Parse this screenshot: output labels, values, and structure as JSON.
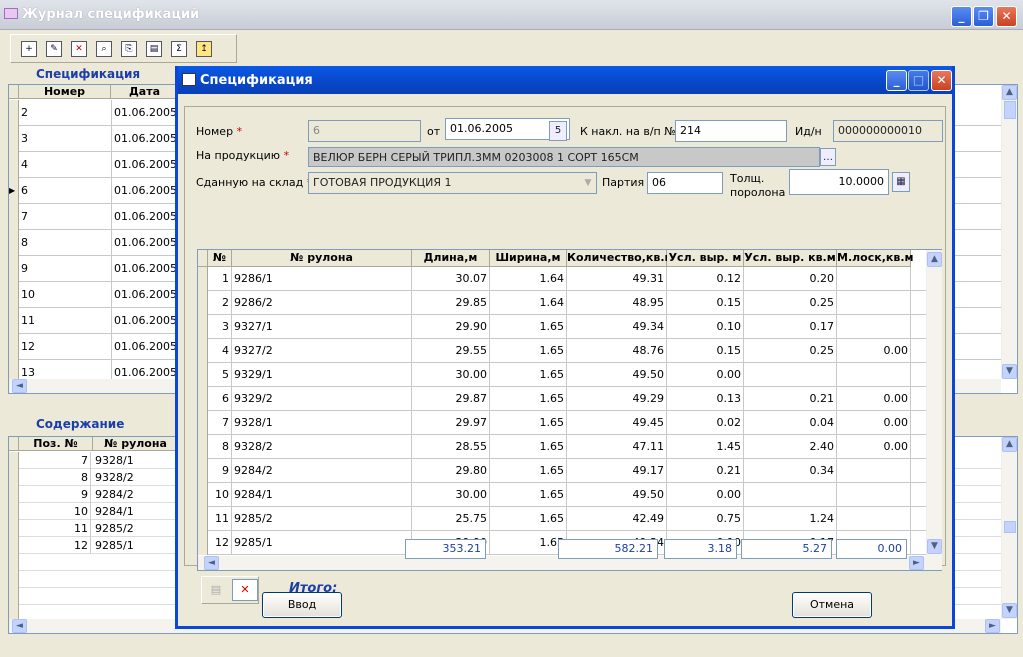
{
  "main": {
    "title": "Журнал спецификаций",
    "spec_section": "Спецификация",
    "content_section": "Содержание",
    "spec_headers": [
      "Номер",
      "Дата"
    ],
    "spec_rows": [
      {
        "num": "2",
        "date": "01.06.2005"
      },
      {
        "num": "3",
        "date": "01.06.2005"
      },
      {
        "num": "4",
        "date": "01.06.2005"
      },
      {
        "num": "6",
        "date": "01.06.2005"
      },
      {
        "num": "7",
        "date": "01.06.2005"
      },
      {
        "num": "8",
        "date": "01.06.2005"
      },
      {
        "num": "9",
        "date": "01.06.2005"
      },
      {
        "num": "10",
        "date": "01.06.2005"
      },
      {
        "num": "11",
        "date": "01.06.2005"
      },
      {
        "num": "12",
        "date": "01.06.2005"
      },
      {
        "num": "13",
        "date": "01.06.2005"
      }
    ],
    "content_headers": [
      "Поз. №",
      "№ рулона"
    ],
    "content_rows": [
      {
        "pos": "7",
        "roll": "9328/1"
      },
      {
        "pos": "8",
        "roll": "9328/2"
      },
      {
        "pos": "9",
        "roll": "9284/2"
      },
      {
        "pos": "10",
        "roll": "9284/1"
      },
      {
        "pos": "11",
        "roll": "9285/2"
      },
      {
        "pos": "12",
        "roll": "9285/1"
      }
    ]
  },
  "dialog": {
    "title": "Спецификация",
    "number_label": "Номер",
    "number_value": "6",
    "from_label": "от",
    "date_value": "01.06.2005",
    "invoice_label": "К накл. на в/п №",
    "invoice_value": "214",
    "id_label": "Ид/н",
    "id_value": "000000000010",
    "product_label": "На продукцию",
    "product_value": "ВЕЛЮР БЕРН СЕРЫЙ ТРИПЛ.3ММ 0203008 1 СОРТ 165СМ",
    "warehouse_label": "Сданную на склад",
    "warehouse_value": "ГОТОВАЯ ПРОДУКЦИЯ  1",
    "batch_label": "Партия",
    "batch_value": "06",
    "foam_label_1": "Толщ.",
    "foam_label_2": "поролона",
    "foam_value": "10.0000",
    "headers": [
      "№",
      "№ рулона",
      "Длина,м",
      "Ширина,м",
      "Количество,кв.м",
      "Усл. выр. м",
      "Усл. выр. кв.м",
      "М.лоск,кв.м"
    ],
    "rows": [
      [
        "1",
        "9286/1",
        "30.07",
        "1.64",
        "49.31",
        "0.12",
        "0.20",
        ""
      ],
      [
        "2",
        "9286/2",
        "29.85",
        "1.64",
        "48.95",
        "0.15",
        "0.25",
        ""
      ],
      [
        "3",
        "9327/1",
        "29.90",
        "1.65",
        "49.34",
        "0.10",
        "0.17",
        ""
      ],
      [
        "4",
        "9327/2",
        "29.55",
        "1.65",
        "48.76",
        "0.15",
        "0.25",
        "0.00"
      ],
      [
        "5",
        "9329/1",
        "30.00",
        "1.65",
        "49.50",
        "0.00",
        "",
        ""
      ],
      [
        "6",
        "9329/2",
        "29.87",
        "1.65",
        "49.29",
        "0.13",
        "0.21",
        "0.00"
      ],
      [
        "7",
        "9328/1",
        "29.97",
        "1.65",
        "49.45",
        "0.02",
        "0.04",
        "0.00"
      ],
      [
        "8",
        "9328/2",
        "28.55",
        "1.65",
        "47.11",
        "1.45",
        "2.40",
        "0.00"
      ],
      [
        "9",
        "9284/2",
        "29.80",
        "1.65",
        "49.17",
        "0.21",
        "0.34",
        ""
      ],
      [
        "10",
        "9284/1",
        "30.00",
        "1.65",
        "49.50",
        "0.00",
        "",
        ""
      ],
      [
        "11",
        "9285/2",
        "25.75",
        "1.65",
        "42.49",
        "0.75",
        "1.24",
        ""
      ],
      [
        "12",
        "9285/1",
        "29.90",
        "1.65",
        "49.34",
        "0.10",
        "0.17",
        ""
      ]
    ],
    "total_label": "Итого:",
    "totals": {
      "length": "353.21",
      "qty": "582.21",
      "usl_m": "3.18",
      "usl_kvm": "5.27",
      "mlosk": "0.00"
    },
    "ok_label": "Ввод",
    "cancel_label": "Отмена"
  }
}
